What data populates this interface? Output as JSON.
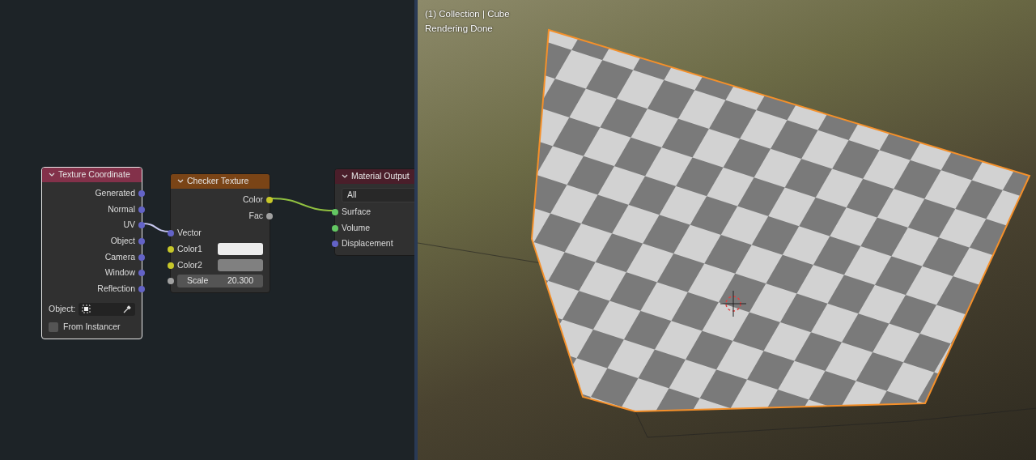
{
  "node_editor": {
    "nodes": [
      {
        "title": "Texture Coordinate",
        "kind": "input",
        "outputs": [
          {
            "label": "Generated",
            "kind": "vector"
          },
          {
            "label": "Normal",
            "kind": "vector"
          },
          {
            "label": "UV",
            "kind": "vector"
          },
          {
            "label": "Object",
            "kind": "vector"
          },
          {
            "label": "Camera",
            "kind": "vector"
          },
          {
            "label": "Window",
            "kind": "vector"
          },
          {
            "label": "Reflection",
            "kind": "vector"
          }
        ],
        "object_field": {
          "label": "Object:"
        },
        "checkbox": {
          "label": "From Instancer",
          "checked": false
        }
      },
      {
        "title": "Checker Texture",
        "kind": "texture",
        "outputs": [
          {
            "label": "Color",
            "kind": "color"
          },
          {
            "label": "Fac",
            "kind": "float"
          }
        ],
        "inputs": [
          {
            "label": "Vector",
            "kind": "vector"
          },
          {
            "label": "Color1",
            "kind": "color",
            "color": "#ececec"
          },
          {
            "label": "Color2",
            "kind": "color",
            "color": "#808080"
          },
          {
            "label": "Scale",
            "kind": "float",
            "value": "20.300"
          }
        ]
      },
      {
        "title": "Material Output",
        "kind": "output",
        "dropdown": "All",
        "inputs": [
          {
            "label": "Surface",
            "kind": "shader"
          },
          {
            "label": "Volume",
            "kind": "shader"
          },
          {
            "label": "Displacement",
            "kind": "vector"
          }
        ]
      }
    ]
  },
  "viewport": {
    "overlay_lines": [
      "(1) Collection | Cube",
      "Rendering Done"
    ]
  }
}
